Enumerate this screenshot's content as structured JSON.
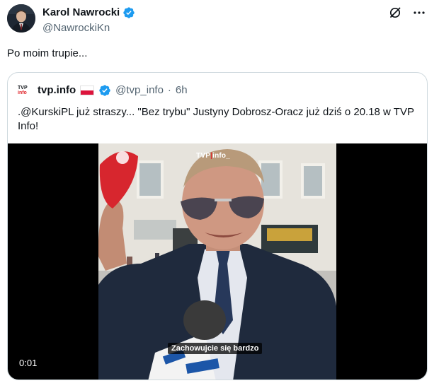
{
  "author": {
    "display_name": "Karol Nawrocki",
    "handle": "@NawrockiKn"
  },
  "tweet": {
    "text": "Po moim trupie..."
  },
  "header_icons": [
    "grok-icon",
    "more-icon"
  ],
  "quoted": {
    "avatar_text_top": "TVP",
    "avatar_text_bottom": "info",
    "display_name": "tvp.info",
    "handle": "@tvp_info",
    "separator": "·",
    "time": "6h",
    "text": ".@KurskiPL już straszy... \"Bez trybu\" Justyny Dobrosz-Oracz już dziś o 20.18 w TVP Info!"
  },
  "video": {
    "timestamp": "0:01",
    "caption": "Zachowujcie się bardzo",
    "logo_left": "TVP",
    "logo_right": "info_"
  },
  "colors": {
    "verified_blue": "#1d9bf0",
    "muted_text": "#536471",
    "border": "#cfd9de",
    "brand_red": "#e0282e"
  }
}
